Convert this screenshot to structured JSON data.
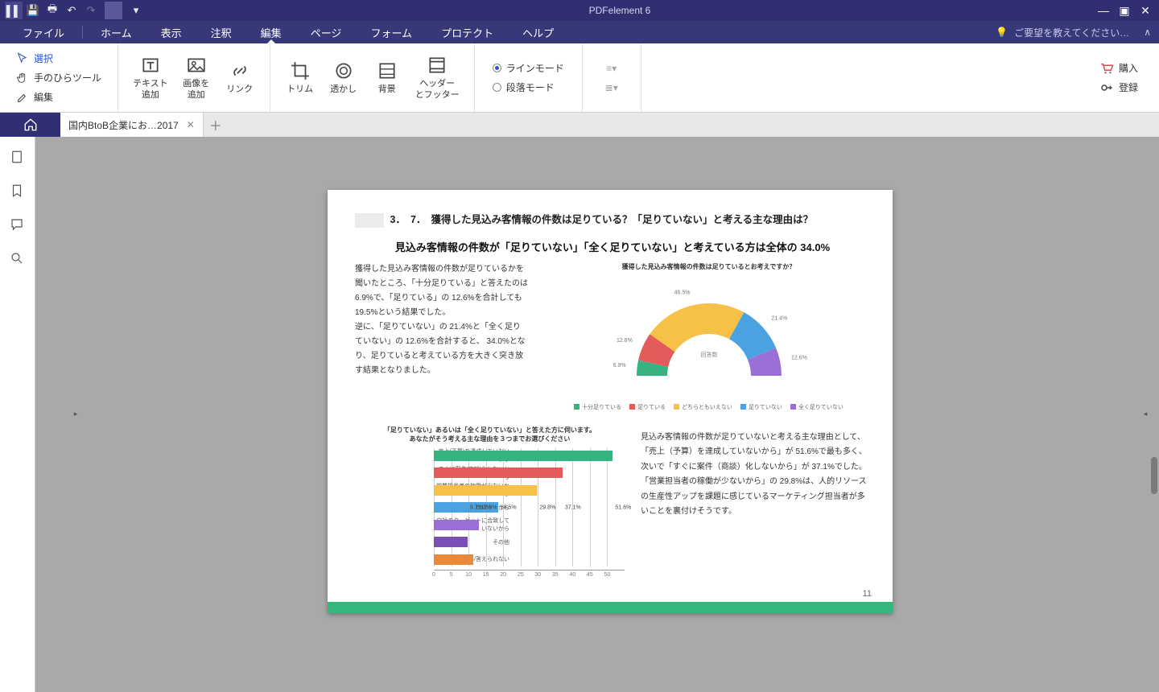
{
  "app": {
    "title": "PDFelement 6"
  },
  "titlebar_icons": [
    "app",
    "save",
    "print",
    "undo",
    "redo",
    "sep",
    "more"
  ],
  "window_controls": [
    "min",
    "max",
    "close"
  ],
  "menu": {
    "items": [
      "ファイル",
      "ホーム",
      "表示",
      "注釈",
      "編集",
      "ページ",
      "フォーム",
      "プロテクト",
      "ヘルプ"
    ],
    "active_index": 4,
    "hint": "ご要望を教えてください…"
  },
  "ribbon": {
    "left_tools": [
      {
        "icon": "cursor",
        "label": "選択",
        "selected": true
      },
      {
        "icon": "hand",
        "label": "手のひらツール"
      },
      {
        "icon": "edit",
        "label": "編集"
      }
    ],
    "big_tools": [
      {
        "icon": "text",
        "label": "テキスト追加"
      },
      {
        "icon": "image",
        "label": "画像を追加"
      },
      {
        "icon": "link",
        "label": "リンク"
      }
    ],
    "big_tools2": [
      {
        "icon": "crop",
        "label": "トリム"
      },
      {
        "icon": "watermark",
        "label": "透かし"
      },
      {
        "icon": "bg",
        "label": "背景"
      },
      {
        "icon": "hf",
        "label": "ヘッダーとフッター"
      }
    ],
    "mode": {
      "line": "ラインモード",
      "para": "段落モード",
      "selected": "line"
    },
    "right": {
      "buy": "購入",
      "register": "登録"
    }
  },
  "tab": {
    "name": "国内BtoB企業にお…2017"
  },
  "page": {
    "number": "11",
    "q_num1": "3．",
    "q_num2": "7．",
    "q_text": "獲得した見込み客情報の件数は足りている？「足りていない」と考える主な理由は？",
    "subhead": "見込み客情報の件数が「足りていない」「全く足りていない」と考えている方は全体の 34.0%",
    "body_left": "獲得した見込み客情報の件数が足りているかを聞いたところ、「十分足りている」と答えたのは 6.9%で、「足りている」の 12.6%を合計しても 19.5%という結果でした。\n逆に、「足りていない」の 21.4%と「全く足りていない」の 12.6%を合計すると、 34.0%となり、足りていると考えている方を大きく突き放す結果となりました。",
    "body_right": "見込み客情報の件数が足りていないと考える主な理由として、「売上（予算）を達成していないから」が 51.6%で最も多く、次いで「すぐに案件（商談）化しないから」が 37.1%でした。\n「営業担当者の稼働が少ないから」の 29.8%は、人的リソースの生産性アップを課題に感じているマーケティング担当者が多いことを裏付けそうです。"
  },
  "chart_data": [
    {
      "type": "pie",
      "title": "獲得した見込み客情報の件数は足りているとお考えですか？",
      "legend_label": "回答数",
      "series": [
        {
          "name": "十分足りている",
          "value": 6.9,
          "color": "#36b37e"
        },
        {
          "name": "足りている",
          "value": 12.6,
          "color": "#e35b5b"
        },
        {
          "name": "どちらともいえない",
          "value": 46.5,
          "color": "#f6c146"
        },
        {
          "name": "足りていない",
          "value": 21.4,
          "color": "#4aa3e0"
        },
        {
          "name": "全く足りていない",
          "value": 12.6,
          "color": "#9a6fd6"
        }
      ]
    },
    {
      "type": "bar",
      "title": "「足りていない」あるいは「全く足りていない」と答えた方に伺います。\nあなたがそう考える主な理由を３つまでお選びください",
      "xlabel": "",
      "ylabel": "",
      "ylim": [
        0,
        55
      ],
      "ticks": [
        0,
        5,
        10,
        15,
        20,
        25,
        30,
        35,
        40,
        45,
        50
      ],
      "categories": [
        "売上(予算)を達成していないから",
        "すぐに案件(商談)化しないから",
        "営業担当者の稼働が少ないから",
        "経営層に言われているから",
        "自社のターゲットに合致していないから",
        "その他",
        "わからない/答えられない"
      ],
      "values": [
        51.6,
        37.1,
        29.8,
        18.5,
        12.9,
        9.7,
        11.3
      ],
      "colors": [
        "#36b37e",
        "#e35b5b",
        "#f6c146",
        "#4aa3e0",
        "#9a6fd6",
        "#7b4fb8",
        "#e98a3a"
      ]
    }
  ]
}
